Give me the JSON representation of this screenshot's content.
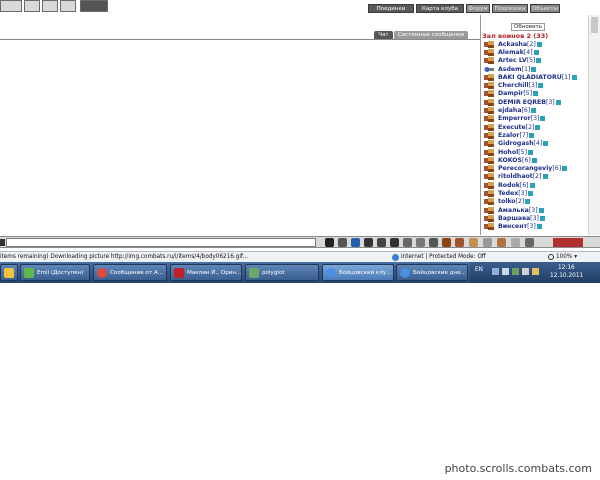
{
  "top_nav": {
    "items": [
      "Поединки",
      "Карта клуба",
      "Форум",
      "Подсказка",
      "Объекты"
    ]
  },
  "chat": {
    "tabs": [
      "Чат",
      "Системные сообщения"
    ]
  },
  "sidebar": {
    "refresh_label": "Обновить",
    "room_title": "Зал воинов 2 (33)",
    "users": [
      {
        "name": "Ackasha",
        "level": "[2]",
        "icon": "clan-icon"
      },
      {
        "name": "Alemak",
        "level": "[4]",
        "icon": "clan-icon"
      },
      {
        "name": "Artec LV",
        "level": "[5]",
        "icon": "clan-icon"
      },
      {
        "name": "Asdem",
        "level": "[1]",
        "icon": "blue-clan-icon"
      },
      {
        "name": "BAKI QLADIATORU",
        "level": "[1]",
        "icon": "clan-icon"
      },
      {
        "name": "Cherchill",
        "level": "[3]",
        "icon": "clan-icon"
      },
      {
        "name": "Dampir",
        "level": "[5]",
        "icon": "clan-icon"
      },
      {
        "name": "DEMIR EQREB",
        "level": "[3]",
        "icon": "clan-icon"
      },
      {
        "name": "ejdaha",
        "level": "[6]",
        "icon": "clan-icon"
      },
      {
        "name": "Emperror",
        "level": "[3]",
        "icon": "clan-icon"
      },
      {
        "name": "Execute",
        "level": "[2]",
        "icon": "clan-icon"
      },
      {
        "name": "Ezalor",
        "level": "[7]",
        "icon": "clan-icon"
      },
      {
        "name": "Gidrogash",
        "level": "[4]",
        "icon": "clan-icon"
      },
      {
        "name": "Hohol",
        "level": "[5]",
        "icon": "clan-icon"
      },
      {
        "name": "KOKOS",
        "level": "[6]",
        "icon": "clan-icon"
      },
      {
        "name": "Perecorangeviy",
        "level": "[6]",
        "icon": "clan-icon"
      },
      {
        "name": "ritoldhaot",
        "level": "[2]",
        "icon": "clan-icon"
      },
      {
        "name": "Rodok",
        "level": "[6]",
        "icon": "clan-icon"
      },
      {
        "name": "Tedex",
        "level": "[3]",
        "icon": "clan-icon"
      },
      {
        "name": "tolko",
        "level": "[2]",
        "icon": "clan-icon"
      },
      {
        "name": "Амалька",
        "level": "[3]",
        "icon": "clan-icon"
      },
      {
        "name": "Варшава",
        "level": "[3]",
        "icon": "clan-icon"
      },
      {
        "name": "Винсент",
        "level": "[3]",
        "icon": "clan-icon"
      }
    ]
  },
  "status_bar": {
    "text": "items remaining) Downloading picture http://img.combats.ru/i/items/4/body06216.gif...",
    "zone": "Internet | Protected Mode: Off",
    "zoom": "100%"
  },
  "taskbar": {
    "buttons": [
      {
        "label": "",
        "icon": "windows-icon"
      },
      {
        "label": "Emil (Доступен)",
        "icon": "messenger-icon"
      },
      {
        "label": "Сообщение от А...",
        "icon": "chrome-icon"
      },
      {
        "label": "Маклин Й., Орин...",
        "icon": "pdf-icon"
      },
      {
        "label": "polyglot",
        "icon": "app-icon"
      },
      {
        "label": "Бойцовский клу...",
        "icon": "ie-icon"
      },
      {
        "label": "Бойцовские дне...",
        "icon": "ie-icon"
      }
    ],
    "language": "EN",
    "time": "12:16",
    "date": "12.10.2011"
  },
  "watermark": "photo.scrolls.combats.com",
  "colors": {
    "room_title": "#b22222",
    "user_name": "#1f2f8a",
    "info_badge": "#2aa3b8",
    "taskbar": "#2f5483"
  }
}
